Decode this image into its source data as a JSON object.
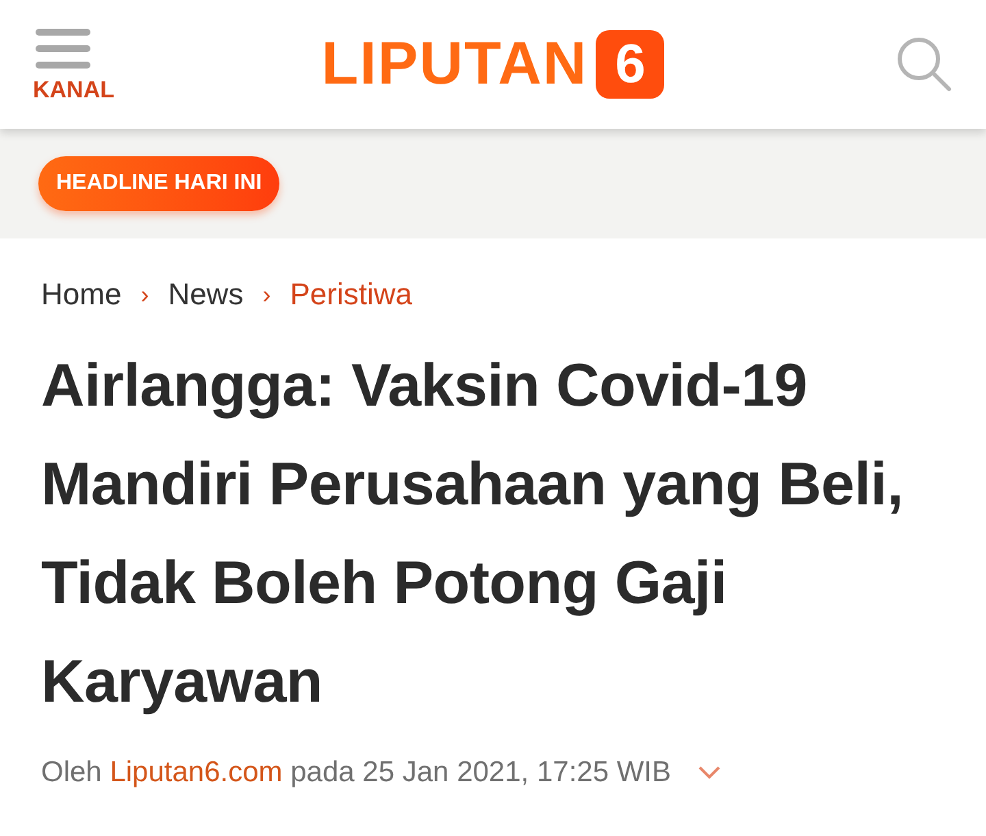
{
  "header": {
    "menu_label": "KANAL",
    "logo_text": "LIPUTAN",
    "logo_badge": "6"
  },
  "headline_button": "HEADLINE HARI INI",
  "breadcrumbs": [
    {
      "label": "Home",
      "current": false
    },
    {
      "separator": "›",
      "label": "News",
      "current": false
    },
    {
      "separator": "›",
      "label": "Peristiwa",
      "current": true
    }
  ],
  "title": "Airlangga: Vaksin Covid-19 Mandiri Perusahaan yang Beli, Tidak Boleh Potong Gaji Karyawan",
  "byline": {
    "prefix": "Oleh",
    "author": "Liputan6.com",
    "date": "pada 25 Jan 2021, 17:25 WIB"
  }
}
